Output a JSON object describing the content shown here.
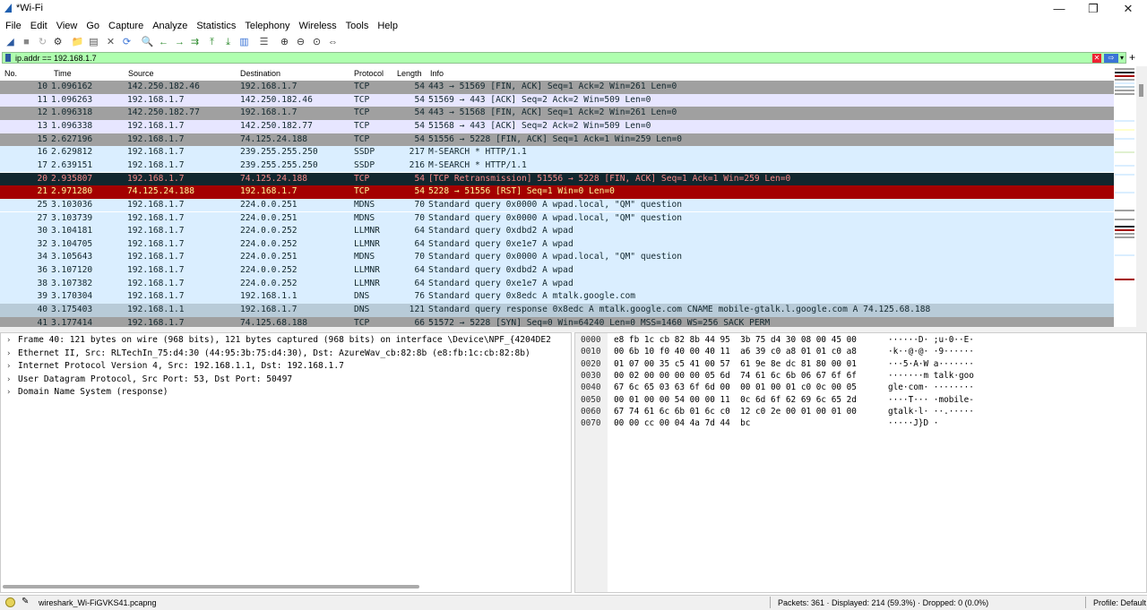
{
  "window": {
    "title": "*Wi-Fi",
    "minimize_glyph": "—",
    "maximize_glyph": "❐",
    "close_glyph": "✕"
  },
  "menu": [
    "File",
    "Edit",
    "View",
    "Go",
    "Capture",
    "Analyze",
    "Statistics",
    "Telephony",
    "Wireless",
    "Tools",
    "Help"
  ],
  "toolbar_icons": [
    "shark-fin-start-icon",
    "stop-icon",
    "restart-icon",
    "options-gear-icon",
    "open-folder-icon",
    "save-file-icon",
    "close-file-icon",
    "reload-icon",
    "find-icon",
    "go-back-icon",
    "go-forward-icon",
    "go-to-packet-icon",
    "first-packet-icon",
    "last-packet-icon",
    "autoscroll-icon",
    "colorize-icon",
    "zoom-in-icon",
    "zoom-out-icon",
    "normal-size-icon",
    "resize-columns-icon"
  ],
  "filter": {
    "value": "ip.addr == 192.168.1.7",
    "clear_glyph": "✕",
    "apply_glyph": "⇨",
    "dropdown_glyph": "▾",
    "add_glyph": "+"
  },
  "packet_list": {
    "columns": [
      "No.",
      "Time",
      "Source",
      "Destination",
      "Protocol",
      "Length",
      "Info"
    ],
    "rows": [
      {
        "no": "10",
        "time": "1.096162",
        "src": "142.250.182.46",
        "dst": "192.168.1.7",
        "proto": "TCP",
        "len": "54",
        "info": "443 → 51569 [FIN, ACK] Seq=1 Ack=2 Win=261 Len=0",
        "bg": "#a0a0a0",
        "fg": "#12272e"
      },
      {
        "no": "11",
        "time": "1.096263",
        "src": "192.168.1.7",
        "dst": "142.250.182.46",
        "proto": "TCP",
        "len": "54",
        "info": "51569 → 443 [ACK] Seq=2 Ack=2 Win=509 Len=0",
        "bg": "#e7e6ff",
        "fg": "#12272e"
      },
      {
        "no": "12",
        "time": "1.096318",
        "src": "142.250.182.77",
        "dst": "192.168.1.7",
        "proto": "TCP",
        "len": "54",
        "info": "443 → 51568 [FIN, ACK] Seq=1 Ack=2 Win=261 Len=0",
        "bg": "#a0a0a0",
        "fg": "#12272e"
      },
      {
        "no": "13",
        "time": "1.096338",
        "src": "192.168.1.7",
        "dst": "142.250.182.77",
        "proto": "TCP",
        "len": "54",
        "info": "51568 → 443 [ACK] Seq=2 Ack=2 Win=509 Len=0",
        "bg": "#e7e6ff",
        "fg": "#12272e"
      },
      {
        "no": "15",
        "time": "2.627196",
        "src": "192.168.1.7",
        "dst": "74.125.24.188",
        "proto": "TCP",
        "len": "54",
        "info": "51556 → 5228 [FIN, ACK] Seq=1 Ack=1 Win=259 Len=0",
        "bg": "#a0a0a0",
        "fg": "#12272e"
      },
      {
        "no": "16",
        "time": "2.629812",
        "src": "192.168.1.7",
        "dst": "239.255.255.250",
        "proto": "SSDP",
        "len": "217",
        "info": "M-SEARCH * HTTP/1.1",
        "bg": "#daeeff",
        "fg": "#12272e"
      },
      {
        "no": "17",
        "time": "2.639151",
        "src": "192.168.1.7",
        "dst": "239.255.255.250",
        "proto": "SSDP",
        "len": "216",
        "info": "M-SEARCH * HTTP/1.1",
        "bg": "#daeeff",
        "fg": "#12272e"
      },
      {
        "no": "20",
        "time": "2.935807",
        "src": "192.168.1.7",
        "dst": "74.125.24.188",
        "proto": "TCP",
        "len": "54",
        "info": "[TCP Retransmission] 51556 → 5228 [FIN, ACK] Seq=1 Ack=1 Win=259 Len=0",
        "bg": "#12272e",
        "fg": "#f78787"
      },
      {
        "no": "21",
        "time": "2.971280",
        "src": "74.125.24.188",
        "dst": "192.168.1.7",
        "proto": "TCP",
        "len": "54",
        "info": "5228 → 51556 [RST] Seq=1 Win=0 Len=0",
        "bg": "#a40000",
        "fg": "#fffc9c"
      },
      {
        "no": "25",
        "time": "3.103036",
        "src": "192.168.1.7",
        "dst": "224.0.0.251",
        "proto": "MDNS",
        "len": "70",
        "info": "Standard query 0x0000 A wpad.local, \"QM\" question",
        "bg": "#daeeff",
        "fg": "#12272e"
      },
      {
        "no": "27",
        "time": "3.103739",
        "src": "192.168.1.7",
        "dst": "224.0.0.251",
        "proto": "MDNS",
        "len": "70",
        "info": "Standard query 0x0000 A wpad.local, \"QM\" question",
        "bg": "#daeeff",
        "fg": "#12272e"
      },
      {
        "no": "30",
        "time": "3.104181",
        "src": "192.168.1.7",
        "dst": "224.0.0.252",
        "proto": "LLMNR",
        "len": "64",
        "info": "Standard query 0xdbd2 A wpad",
        "bg": "#daeeff",
        "fg": "#12272e"
      },
      {
        "no": "32",
        "time": "3.104705",
        "src": "192.168.1.7",
        "dst": "224.0.0.252",
        "proto": "LLMNR",
        "len": "64",
        "info": "Standard query 0xe1e7 A wpad",
        "bg": "#daeeff",
        "fg": "#12272e"
      },
      {
        "no": "34",
        "time": "3.105643",
        "src": "192.168.1.7",
        "dst": "224.0.0.251",
        "proto": "MDNS",
        "len": "70",
        "info": "Standard query 0x0000 A wpad.local, \"QM\" question",
        "bg": "#daeeff",
        "fg": "#12272e"
      },
      {
        "no": "36",
        "time": "3.107120",
        "src": "192.168.1.7",
        "dst": "224.0.0.252",
        "proto": "LLMNR",
        "len": "64",
        "info": "Standard query 0xdbd2 A wpad",
        "bg": "#daeeff",
        "fg": "#12272e"
      },
      {
        "no": "38",
        "time": "3.107382",
        "src": "192.168.1.7",
        "dst": "224.0.0.252",
        "proto": "LLMNR",
        "len": "64",
        "info": "Standard query 0xe1e7 A wpad",
        "bg": "#daeeff",
        "fg": "#12272e"
      },
      {
        "no": "39",
        "time": "3.170304",
        "src": "192.168.1.7",
        "dst": "192.168.1.1",
        "proto": "DNS",
        "len": "76",
        "info": "Standard query 0x8edc A mtalk.google.com",
        "bg": "#daeeff",
        "fg": "#12272e"
      },
      {
        "no": "40",
        "time": "3.175403",
        "src": "192.168.1.1",
        "dst": "192.168.1.7",
        "proto": "DNS",
        "len": "121",
        "info": "Standard query response 0x8edc A mtalk.google.com CNAME mobile-gtalk.l.google.com A 74.125.68.188",
        "bg": "#b8cbd8",
        "fg": "#12272e"
      },
      {
        "no": "41",
        "time": "3.177414",
        "src": "192.168.1.7",
        "dst": "74.125.68.188",
        "proto": "TCP",
        "len": "66",
        "info": "51572 → 5228 [SYN] Seq=0 Win=64240 Len=0 MSS=1460 WS=256 SACK_PERM",
        "bg": "#a0a0a0",
        "fg": "#12272e"
      }
    ]
  },
  "details": [
    "Frame 40: 121 bytes on wire (968 bits), 121 bytes captured (968 bits) on interface \\Device\\NPF_{4204DE2",
    "Ethernet II, Src: RLTechIn_75:d4:30 (44:95:3b:75:d4:30), Dst: AzureWav_cb:82:8b (e8:fb:1c:cb:82:8b)",
    "Internet Protocol Version 4, Src: 192.168.1.1, Dst: 192.168.1.7",
    "User Datagram Protocol, Src Port: 53, Dst Port: 50497",
    "Domain Name System (response)"
  ],
  "detail_arrow": "›",
  "bytes": [
    {
      "off": "0000",
      "hex": "e8 fb 1c cb 82 8b 44 95  3b 75 d4 30 08 00 45 00",
      "ascii": "······D· ;u·0··E·"
    },
    {
      "off": "0010",
      "hex": "00 6b 10 f0 40 00 40 11  a6 39 c0 a8 01 01 c0 a8",
      "ascii": "·k··@·@· ·9······"
    },
    {
      "off": "0020",
      "hex": "01 07 00 35 c5 41 00 57  61 9e 8e dc 81 80 00 01",
      "ascii": "···5·A·W a·······"
    },
    {
      "off": "0030",
      "hex": "00 02 00 00 00 00 05 6d  74 61 6c 6b 06 67 6f 6f",
      "ascii": "·······m talk·goo"
    },
    {
      "off": "0040",
      "hex": "67 6c 65 03 63 6f 6d 00  00 01 00 01 c0 0c 00 05",
      "ascii": "gle·com· ········"
    },
    {
      "off": "0050",
      "hex": "00 01 00 00 54 00 00 11  0c 6d 6f 62 69 6c 65 2d",
      "ascii": "····T··· ·mobile-"
    },
    {
      "off": "0060",
      "hex": "67 74 61 6c 6b 01 6c c0  12 c0 2e 00 01 00 01 00",
      "ascii": "gtalk·l· ··.·····"
    },
    {
      "off": "0070",
      "hex": "00 00 cc 00 04 4a 7d 44  bc",
      "ascii": "·····J}D ·"
    }
  ],
  "status": {
    "file": "wireshark_Wi-FiGVKS41.pcapng",
    "stats": "Packets: 361 · Displayed: 214 (59.3%) · Dropped: 0 (0.0%)",
    "profile": "Profile: Default",
    "edit_glyph": "✎"
  },
  "colors": {
    "filter_valid": "#afffaf",
    "selected_row": "#b8cbd8"
  }
}
